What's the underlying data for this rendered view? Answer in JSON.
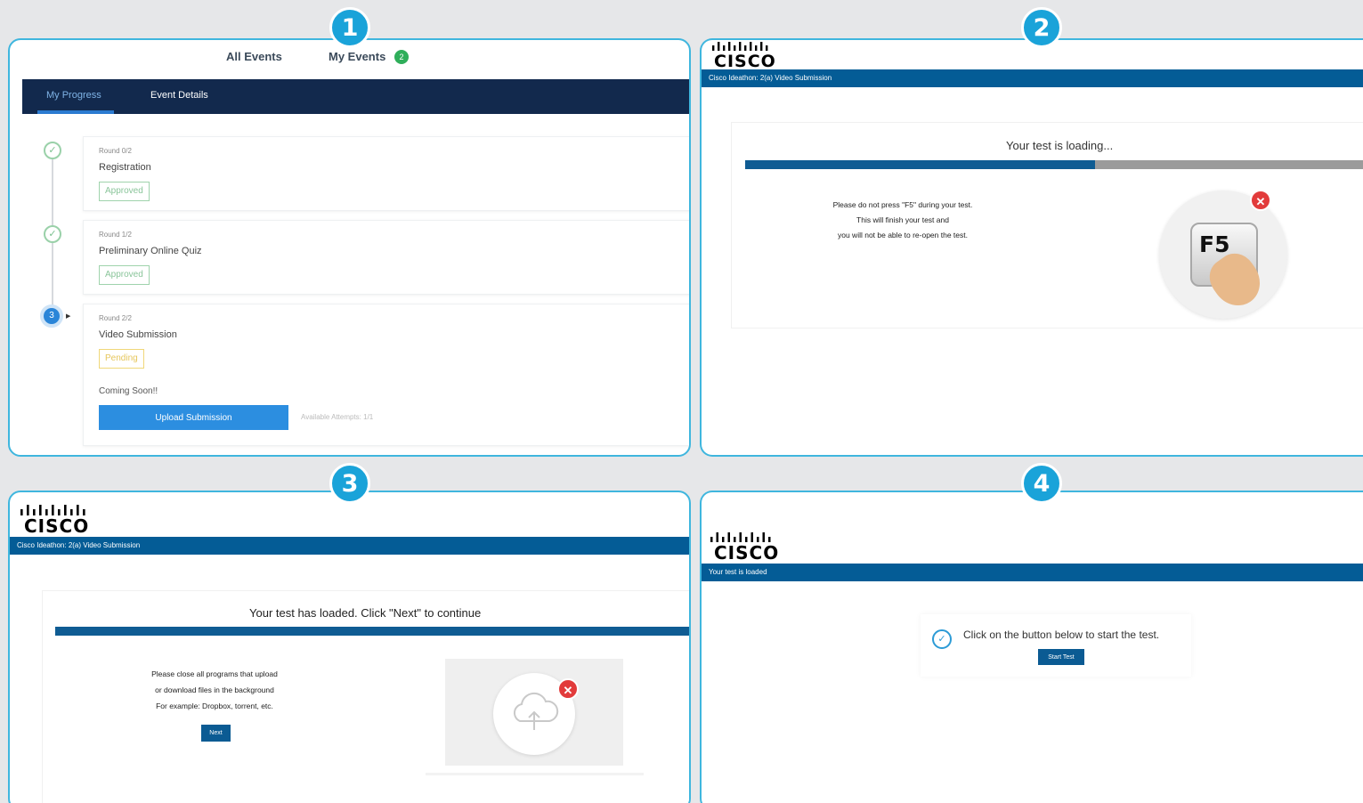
{
  "badges": [
    "1",
    "2",
    "3",
    "4"
  ],
  "panel1": {
    "tabs": {
      "all_events": "All Events",
      "my_events": "My Events",
      "my_events_count": "2"
    },
    "nav": {
      "progress": "My Progress",
      "details": "Event Details"
    },
    "rounds": [
      {
        "round": "Round 0/2",
        "title": "Registration",
        "status": "Approved"
      },
      {
        "round": "Round 1/2",
        "title": "Preliminary Online Quiz",
        "status": "Approved"
      },
      {
        "round": "Round 2/2",
        "title": "Video Submission",
        "status": "Pending",
        "step": "3",
        "note": "Coming Soon!!",
        "button": "Upload Submission",
        "attempts": "Available Attempts: 1/1"
      }
    ]
  },
  "panel2": {
    "logo": "CISCO",
    "bar": "Cisco Ideathon: 2(a) Video Submission",
    "loading": "Your test is loading...",
    "progress_fraction": 0.55,
    "warning": [
      "Please do not press \"F5\" during your test.",
      "This will finish your test and",
      "you will not be able to re-open the test."
    ],
    "key": "F5"
  },
  "panel3": {
    "logo": "CISCO",
    "bar": "Cisco Ideathon: 2(a) Video Submission",
    "loaded": "Your test has loaded. Click \"Next\" to continue",
    "notice": [
      "Please close all programs that upload",
      "or download files in the background",
      "For example: Dropbox, torrent, etc."
    ],
    "next": "Next"
  },
  "panel4": {
    "logo": "CISCO",
    "bar": "Your test is loaded",
    "instruction": "Click on the button below to start the test.",
    "start": "Start Test"
  },
  "colors": {
    "accent": "#1aa3d9",
    "cisco_blue": "#045c96",
    "nav_dark": "#12294d",
    "button_blue": "#2c8ee0",
    "alert_red": "#e23b3b"
  },
  "icons": [
    "check-icon",
    "f5-key-icon",
    "close-icon",
    "cloud-upload-icon",
    "cisco-logo-icon"
  ]
}
